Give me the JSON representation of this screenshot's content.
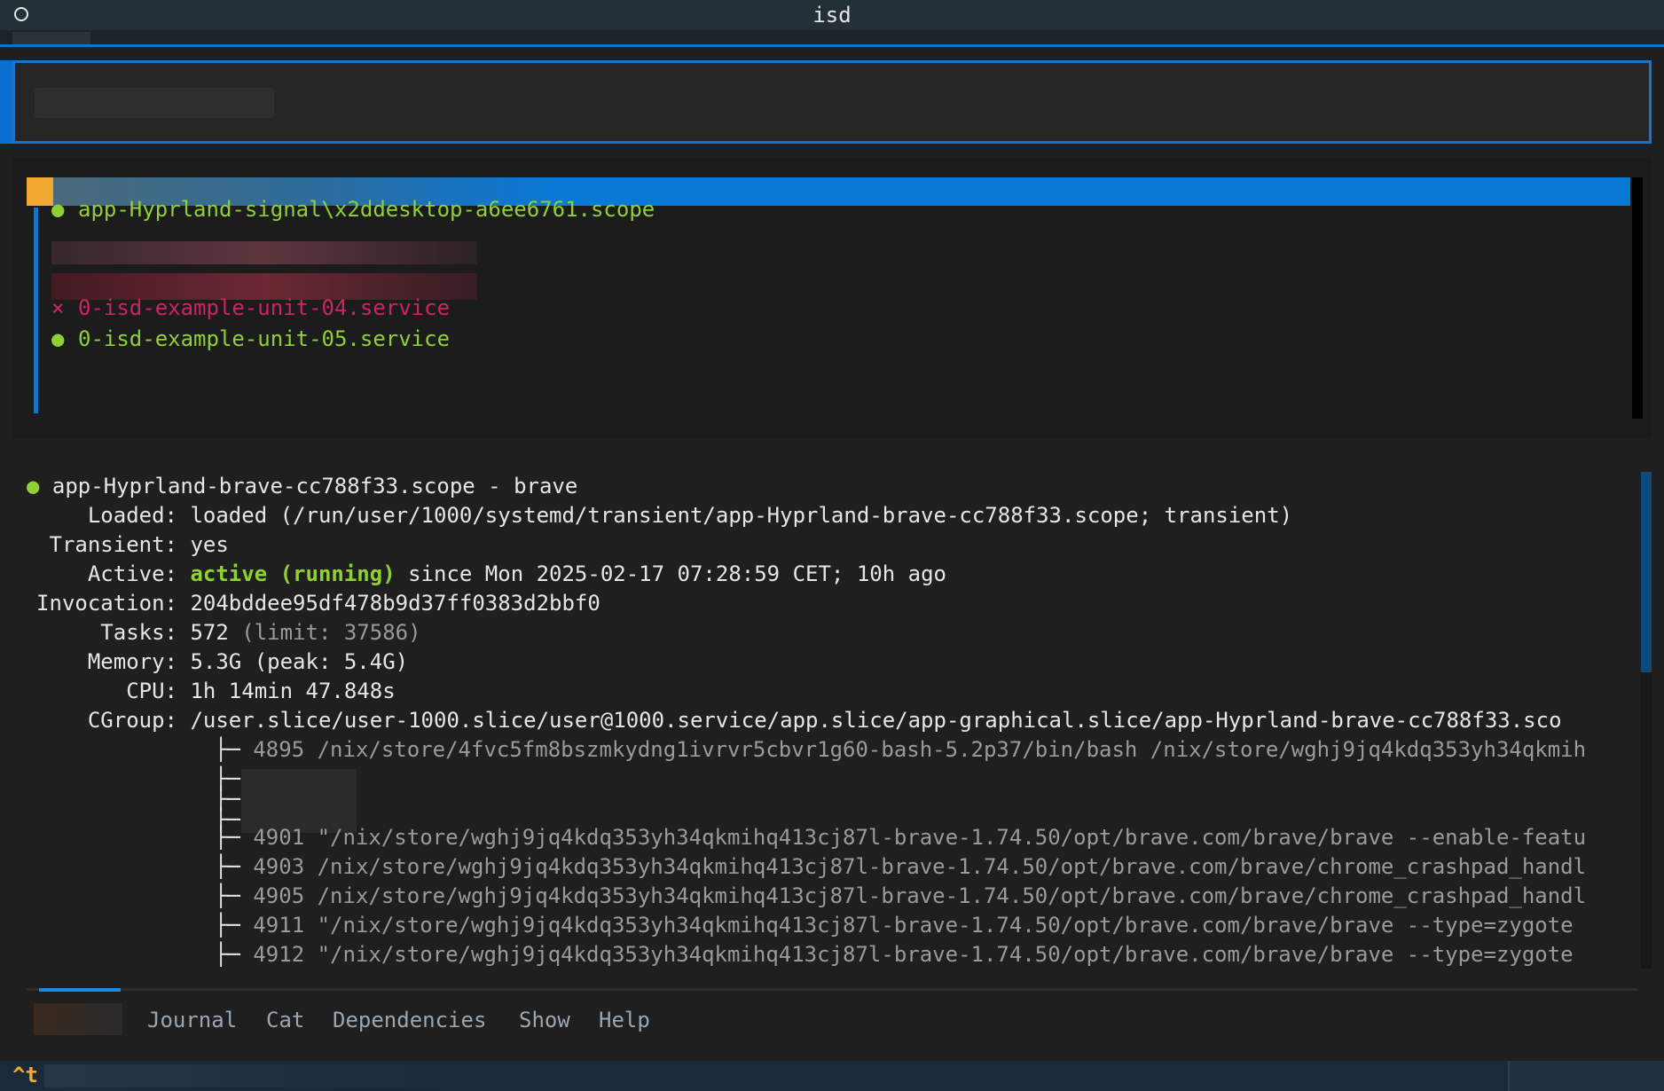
{
  "window": {
    "title": "isd"
  },
  "search": {
    "value": ""
  },
  "units": [
    {
      "state": "active",
      "symbol": "●",
      "name": "app-Hyprland-signal\\x2ddesktop-a6ee6761.scope"
    },
    {
      "state": "failed",
      "symbol": "×",
      "name": "0-isd-example-unit-04.service"
    },
    {
      "state": "active",
      "symbol": "●",
      "name": "0-isd-example-unit-05.service"
    }
  ],
  "details": {
    "symbol": "●",
    "header": "app-Hyprland-brave-cc788f33.scope - brave",
    "fields": {
      "loaded_label": "Loaded:",
      "loaded_value": "loaded (/run/user/1000/systemd/transient/app-Hyprland-brave-cc788f33.scope; transient)",
      "transient_label": "Transient:",
      "transient_value": "yes",
      "active_label": "Active:",
      "active_state": "active (running)",
      "active_since": "since Mon 2025-02-17 07:28:59 CET; 10h ago",
      "invocation_label": "Invocation:",
      "invocation_value": "204bddee95df478b9d37ff0383d2bbf0",
      "tasks_label": "Tasks:",
      "tasks_value": "572",
      "tasks_limit": "(limit: 37586)",
      "memory_label": "Memory:",
      "memory_value": "5.3G (peak: 5.4G)",
      "cpu_label": "CPU:",
      "cpu_value": "1h 14min 47.848s",
      "cgroup_label": "CGroup:",
      "cgroup_value": "/user.slice/user-1000.slice/user@1000.service/app.slice/app-graphical.slice/app-Hyprland-brave-cc788f33.sco"
    },
    "processes": [
      {
        "prefix": "├─",
        "pid": "4895",
        "cmd": "/nix/store/4fvc5fm8bszmkydng1ivrvr5cbvr1g60-bash-5.2p37/bin/bash /nix/store/wghj9jq4kdq353yh34qkmih"
      },
      {
        "prefix": "├─",
        "pid": "",
        "cmd": ""
      },
      {
        "prefix": "├─",
        "pid": "",
        "cmd": ""
      },
      {
        "prefix": "├─",
        "pid": "",
        "cmd": ""
      },
      {
        "prefix": "├─",
        "pid": "4901",
        "cmd": "\"/nix/store/wghj9jq4kdq353yh34qkmihq413cj87l-brave-1.74.50/opt/brave.com/brave/brave --enable-featu"
      },
      {
        "prefix": "├─",
        "pid": "4903",
        "cmd": "/nix/store/wghj9jq4kdq353yh34qkmihq413cj87l-brave-1.74.50/opt/brave.com/brave/chrome_crashpad_handl"
      },
      {
        "prefix": "├─",
        "pid": "4905",
        "cmd": "/nix/store/wghj9jq4kdq353yh34qkmihq413cj87l-brave-1.74.50/opt/brave.com/brave/chrome_crashpad_handl"
      },
      {
        "prefix": "├─",
        "pid": "4911",
        "cmd": "\"/nix/store/wghj9jq4kdq353yh34qkmihq413cj87l-brave-1.74.50/opt/brave.com/brave/brave --type=zygote"
      },
      {
        "prefix": "├─",
        "pid": "4912",
        "cmd": "\"/nix/store/wghj9jq4kdq353yh34qkmihq413cj87l-brave-1.74.50/opt/brave.com/brave/brave --type=zygote"
      }
    ]
  },
  "tabs": [
    {
      "label": "Journal"
    },
    {
      "label": "Cat"
    },
    {
      "label": "Dependencies"
    },
    {
      "label": "Show"
    },
    {
      "label": "Help"
    }
  ],
  "statusbar": {
    "key": "^t"
  },
  "colors": {
    "accent": "#0a78d6",
    "active": "#8fd036",
    "failed": "#d0245c",
    "highlight": "#f0a830"
  }
}
